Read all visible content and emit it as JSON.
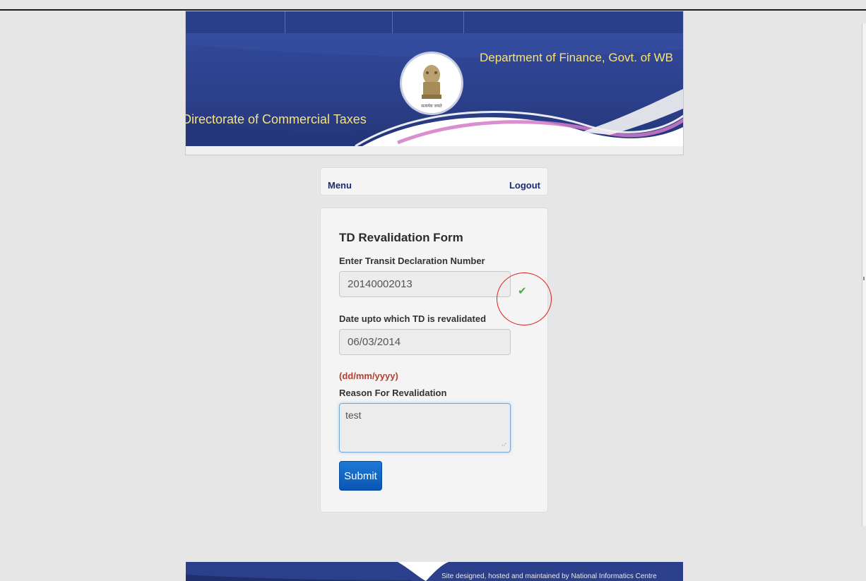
{
  "header": {
    "department": "Department of Finance, Govt. of WB",
    "directorate": "Directorate of Commercial Taxes",
    "emblem_caption": "सत्यमेव जयते"
  },
  "menubar": {
    "menu_label": "Menu",
    "logout_label": "Logout"
  },
  "form": {
    "title": "TD Revalidation Form",
    "td_number_label": "Enter Transit Declaration Number",
    "td_number_value": "20140002013",
    "date_label": "Date upto which TD is revalidated",
    "date_value": "06/03/2014",
    "date_hint": "(dd/mm/yyyy)",
    "reason_label": "Reason For Revalidation",
    "reason_value": "test",
    "submit_label": "Submit",
    "validation_icon": "check-icon"
  },
  "footer": {
    "credit": "Site designed, hosted and maintained by National Informatics Centre"
  },
  "colors": {
    "banner_blue": "#2b3f8a",
    "banner_text": "#f5e37c",
    "hint_red": "#b0402f",
    "submit_blue": "#0a55b3",
    "annotation_circle": "#e02020",
    "check_green": "#4fa64a"
  }
}
